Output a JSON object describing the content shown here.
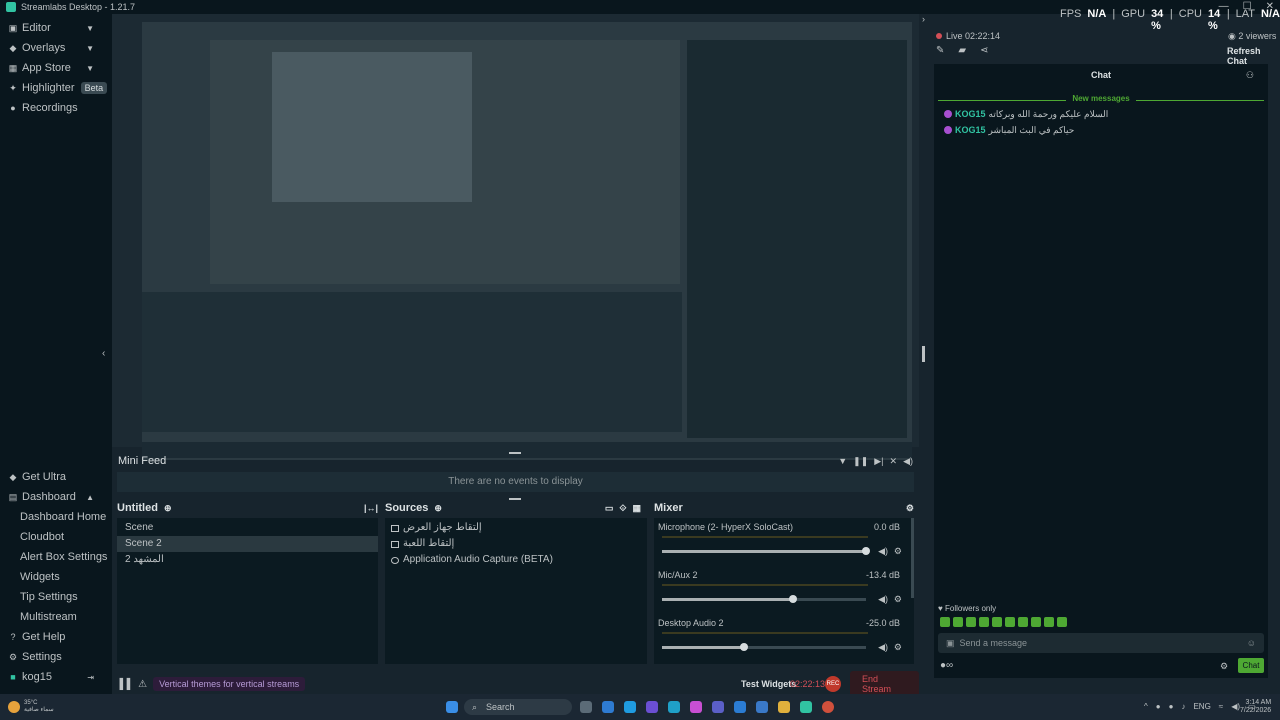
{
  "window": {
    "title": "Streamlabs Desktop - 1.21.7"
  },
  "nav": {
    "editor": "Editor",
    "overlays": "Overlays",
    "app_store": "App Store",
    "highlighter": "Highlighter",
    "highlighter_badge": "Beta",
    "recordings": "Recordings",
    "get_ultra": "Get Ultra",
    "dashboard": "Dashboard",
    "dashboard_sub": [
      "Dashboard Home",
      "Cloudbot",
      "Alert Box Settings",
      "Widgets",
      "Tip Settings",
      "Multistream"
    ],
    "get_help": "Get Help",
    "settings": "Settings",
    "username": "kog15"
  },
  "stats": {
    "fps_label": "FPS",
    "fps": "N/A",
    "gpu_label": "GPU",
    "gpu": "34 %",
    "cpu_label": "CPU",
    "cpu": "14 %",
    "lat_label": "LAT",
    "lat": "N/A"
  },
  "live": {
    "status": "Live 02:22:14",
    "viewers": "2 viewers",
    "refresh": "Refresh Chat"
  },
  "minifeed": {
    "label": "Mini Feed",
    "empty": "There are no events to display"
  },
  "scenes": {
    "title": "Untitled",
    "items": [
      "Scene",
      "Scene 2",
      "المشهد 2"
    ],
    "selected_index": 1
  },
  "sources": {
    "title": "Sources",
    "items": [
      "إلتقاط جهاز العرض",
      "إلتقاط اللعبة",
      "Application Audio Capture (BETA)"
    ]
  },
  "mixer": {
    "title": "Mixer",
    "channels": [
      {
        "name": "Microphone (2- HyperX SoloCast)",
        "db": "0.0 dB",
        "level": 1.0
      },
      {
        "name": "Mic/Aux 2",
        "db": "-13.4 dB",
        "level": 0.64
      },
      {
        "name": "Desktop Audio 2",
        "db": "-25.0 dB",
        "level": 0.4
      }
    ]
  },
  "footer": {
    "theme_banner": "Vertical themes for vertical streams",
    "test_widgets": "Test Widgets",
    "timer": "02:22:13",
    "rec": "REC",
    "end_stream": "End Stream"
  },
  "chat": {
    "title": "Chat",
    "new_messages": "New messages",
    "messages": [
      {
        "user": "KOG15",
        "text": "السلام عليكم ورحمة الله وبركاته"
      },
      {
        "user": "KOG15",
        "text": "حياكم في البث المباشر"
      }
    ],
    "followers_only": "Followers only",
    "input_placeholder": "Send a message",
    "send_button": "Chat"
  },
  "taskbar": {
    "weather_temp": "35°C",
    "weather_desc": "سماء صافية",
    "search": "Search",
    "lang": "ENG",
    "time": "3:14 AM",
    "date": "7/22/2026"
  }
}
